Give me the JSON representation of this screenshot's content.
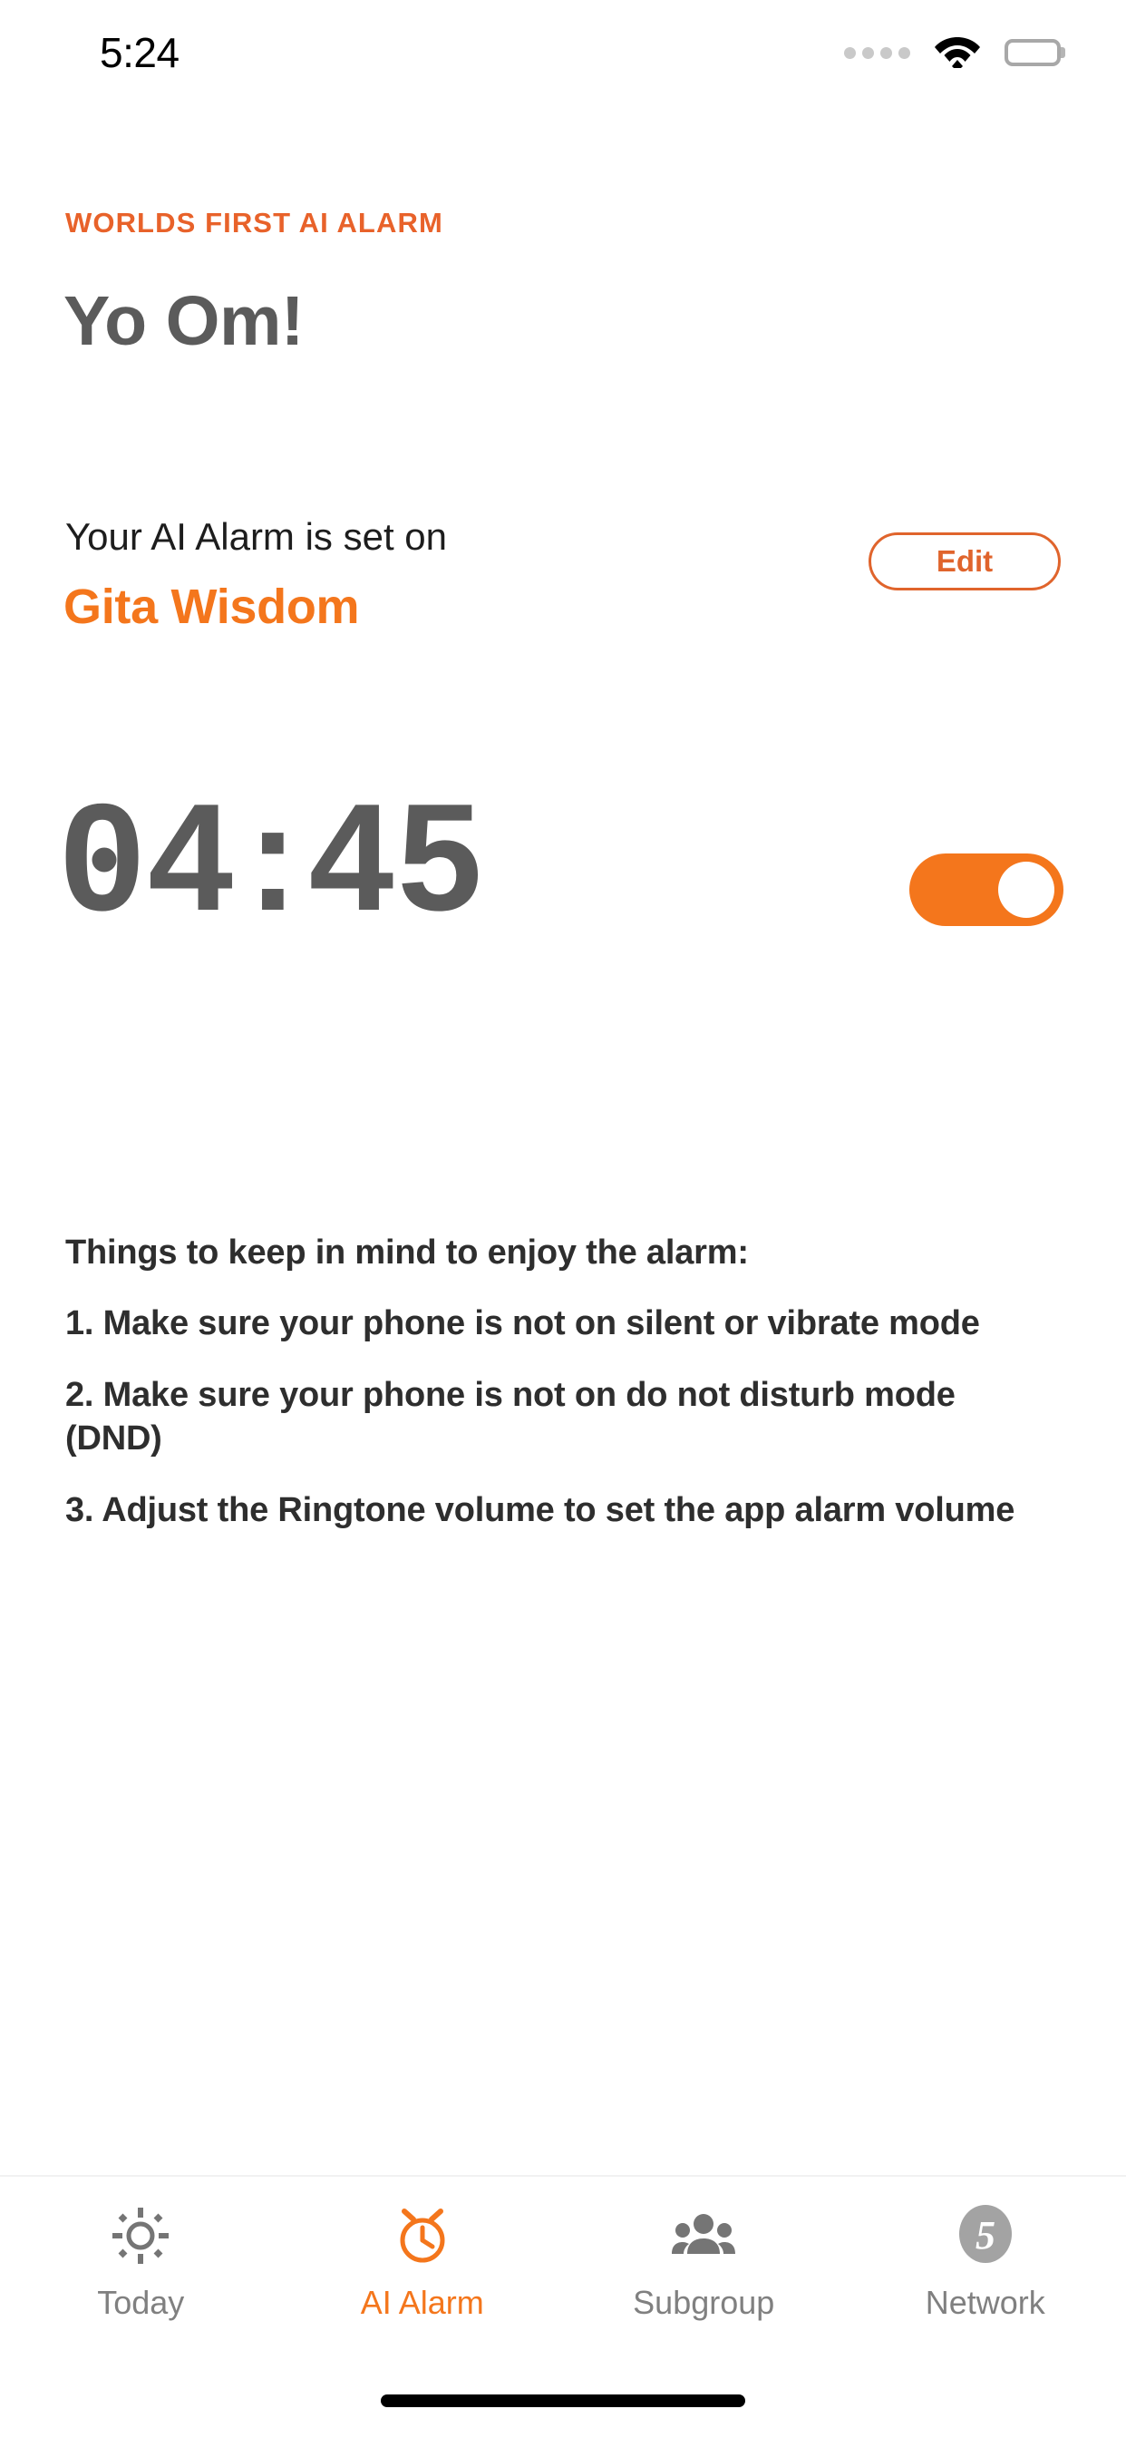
{
  "status_bar": {
    "time": "5:24",
    "signal_icon": "signal-dots-icon",
    "wifi_icon": "wifi-icon",
    "battery_icon": "battery-full-icon"
  },
  "header": {
    "eyebrow": "WORLDS FIRST AI ALARM",
    "greeting": "Yo Om!"
  },
  "alarm": {
    "set_label": "Your AI Alarm is set on",
    "set_name": "Gita Wisdom",
    "edit_label": "Edit",
    "hours": "04",
    "separator": ":",
    "minutes": "45",
    "toggle_state": "on"
  },
  "notes": {
    "title": "Things to keep in mind to enjoy the alarm:",
    "items": [
      "1. Make sure your phone is not on silent or vibrate mode",
      "2. Make sure your phone is not on do not disturb mode (DND)",
      "3. Adjust the Ringtone volume to set the app alarm volume"
    ]
  },
  "tabbar": {
    "items": [
      {
        "label": "Today",
        "icon": "sun-icon",
        "active": false
      },
      {
        "label": "AI Alarm",
        "icon": "alarm-clock-icon",
        "active": true
      },
      {
        "label": "Subgroup",
        "icon": "people-group-icon",
        "active": false
      },
      {
        "label": "Network",
        "icon": "number-five-circle-icon",
        "active": false,
        "badge": "5"
      }
    ]
  },
  "colors": {
    "accent_orange": "#f4761c",
    "eyebrow_orange": "#e8622a",
    "edit_orange": "#e0642c",
    "text_gray": "#5b5b5b",
    "note_gray": "#2e2e2e",
    "tab_gray": "#808080"
  }
}
